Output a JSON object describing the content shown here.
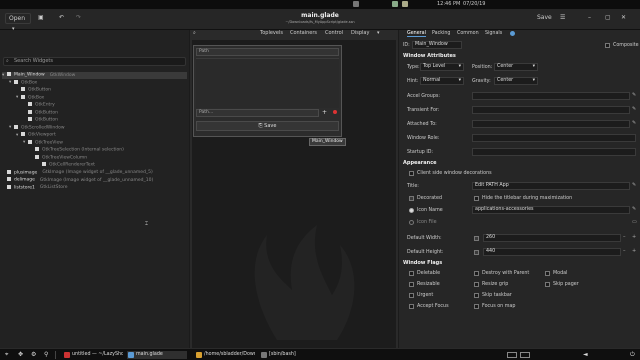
{
  "system": {
    "clock": "12:46 PM",
    "date": "07/20/19"
  },
  "header": {
    "open_label": "Open",
    "title": "main.glade",
    "subtitle": "~/Downloads/fs_MyAppScript/glade.ssn",
    "save_label": "Save"
  },
  "left": {
    "search_placeholder": "Search Widgets",
    "tree": [
      {
        "name": "Main_Window",
        "type": "GtkWindow",
        "level": 0
      },
      {
        "name": "",
        "type": "GtkBox",
        "level": 1
      },
      {
        "name": "",
        "type": "GtkButton",
        "level": 2
      },
      {
        "name": "",
        "type": "GtkBox",
        "level": 2
      },
      {
        "name": "",
        "type": "GtkEntry",
        "level": 3
      },
      {
        "name": "",
        "type": "GtkButton",
        "level": 3
      },
      {
        "name": "",
        "type": "GtkButton",
        "level": 3
      },
      {
        "name": "",
        "type": "GtkScrolledWindow",
        "level": 1
      },
      {
        "name": "",
        "type": "GtkViewport",
        "level": 2
      },
      {
        "name": "",
        "type": "GtkTreeView",
        "level": 3
      },
      {
        "name": "",
        "type": "GtkTreeSelection (Internal selection)",
        "level": 4
      },
      {
        "name": "",
        "type": "GtkTreeViewColumn",
        "level": 4
      },
      {
        "name": "",
        "type": "GtkCellRendererText",
        "level": 5
      },
      {
        "name": "plusimage",
        "type": "GtkImage (Image widget of __glade_unnamed_5)",
        "level": 0
      },
      {
        "name": "delimage",
        "type": "GtkImage (Image widget of __glade_unnamed_10)",
        "level": 0
      },
      {
        "name": "liststore1",
        "type": "GtkListStore",
        "level": 0
      }
    ]
  },
  "center": {
    "tabs": [
      "Toplevels",
      "Containers",
      "Control",
      "Display"
    ],
    "preview": {
      "entry_top": "Path",
      "entry_bottom": "Path...",
      "save_label": "Save",
      "tooltip": "Main_Window"
    }
  },
  "right": {
    "tabs": [
      "General",
      "Packing",
      "Common",
      "Signals"
    ],
    "id_label": "ID:",
    "id_value": "Main_Window",
    "composite_label": "Composite",
    "sec_window_attrs": "Window Attributes",
    "type_label": "Type:",
    "type_value": "Top Level",
    "position_label": "Position:",
    "position_value": "Center",
    "hint_label": "Hint:",
    "hint_value": "Normal",
    "gravity_label": "Gravity:",
    "gravity_value": "Center",
    "accel_label": "Accel Groups:",
    "transient_label": "Transient For:",
    "attached_label": "Attached To:",
    "role_label": "Window Role:",
    "startup_label": "Startup ID:",
    "sec_appearance": "Appearance",
    "csd_label": "Client side window decorations",
    "title_label": "Title:",
    "title_value": "Edit PATH App",
    "decorated_label": "Decorated",
    "hide_titlebar_label": "Hide the titlebar during maximization",
    "icon_name_label": "Icon Name",
    "icon_name_value": "applications-accessories",
    "icon_file_label": "Icon File",
    "def_width_label": "Default Width:",
    "def_width_value": "260",
    "def_height_label": "Default Height:",
    "def_height_value": "440",
    "sec_flags": "Window Flags",
    "flags": [
      [
        "Deletable",
        "Destroy with Parent",
        "Modal"
      ],
      [
        "Resizable",
        "Resize grip",
        "Skip pager"
      ],
      [
        "Urgent",
        "Skip taskbar",
        ""
      ],
      [
        "Accept Focus",
        "Focus on map",
        ""
      ]
    ]
  },
  "taskbar": {
    "items": [
      "untitled — ~/LazySho...",
      "main.glade",
      "/home/sbladder/Downl...",
      "[sbin/bash]"
    ]
  }
}
